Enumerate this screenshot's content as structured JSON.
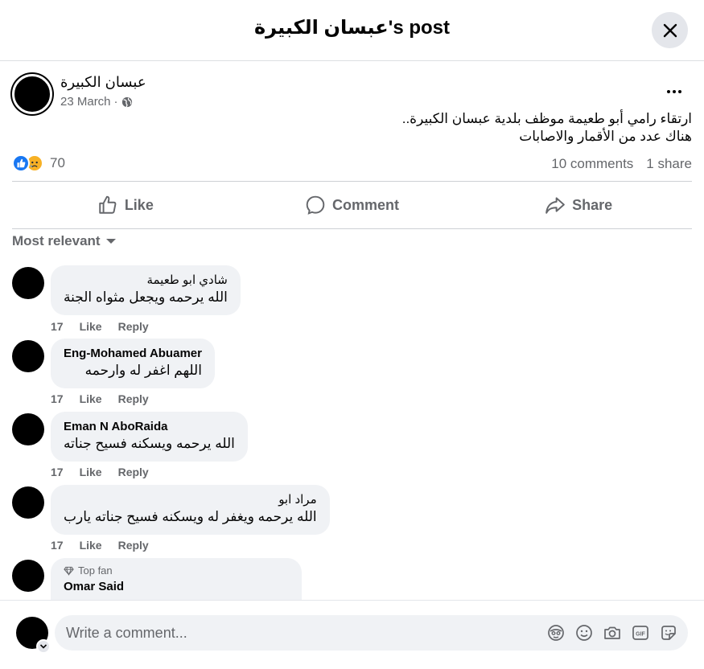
{
  "header": {
    "title": "عبسان الكبيرة's post",
    "close_icon": "close-icon"
  },
  "post": {
    "author": "عبسان الكبيرة",
    "date": "23 March",
    "date_separator": "·",
    "audience_icon": "globe-icon",
    "more_icon": "more-options-icon",
    "text_line1": "ارتقاء رامي أبو طعيمة موظف بلدية عبسان الكبيرة..",
    "text_line2": "هناك عدد من الأقمار والاصابات",
    "reaction_icons": [
      "like-reaction-icon",
      "sad-reaction-icon"
    ],
    "reaction_count": "70",
    "comments_count": "10 comments",
    "shares_count": "1 share"
  },
  "actions": {
    "like": "Like",
    "comment": "Comment",
    "share": "Share"
  },
  "sort": {
    "label": "Most relevant"
  },
  "comments": [
    {
      "name": "شادي ابو طعيمة",
      "text": "الله يرحمه ويجعل مثواه الجنة",
      "time": "17",
      "like": "Like",
      "reply": "Reply"
    },
    {
      "name": "Eng-Mohamed Abuamer",
      "text": "اللهم اغفر له وارحمه",
      "time": "17",
      "like": "Like",
      "reply": "Reply"
    },
    {
      "name": "Eman N AboRaida",
      "text": "الله يرحمه ويسكنه فسيح جناته",
      "time": "17",
      "like": "Like",
      "reply": "Reply"
    },
    {
      "name": "مراد ابو",
      "text": "الله يرحمه ويغفر له ويسكنه فسيح جناته يارب",
      "time": "17",
      "like": "Like",
      "reply": "Reply"
    },
    {
      "badge": "Top fan",
      "badge_icon": "diamond-icon",
      "name": "Omar Said"
    }
  ],
  "composer": {
    "placeholder": "Write a comment...",
    "icons": [
      "avatar-sticker-icon",
      "emoji-icon",
      "camera-icon",
      "gif-icon",
      "sticker-icon"
    ]
  },
  "colors": {
    "accent": "#1877f2",
    "secondary_text": "#65676b",
    "bubble_bg": "#f0f2f5",
    "sad_reaction": "#f7b125"
  }
}
